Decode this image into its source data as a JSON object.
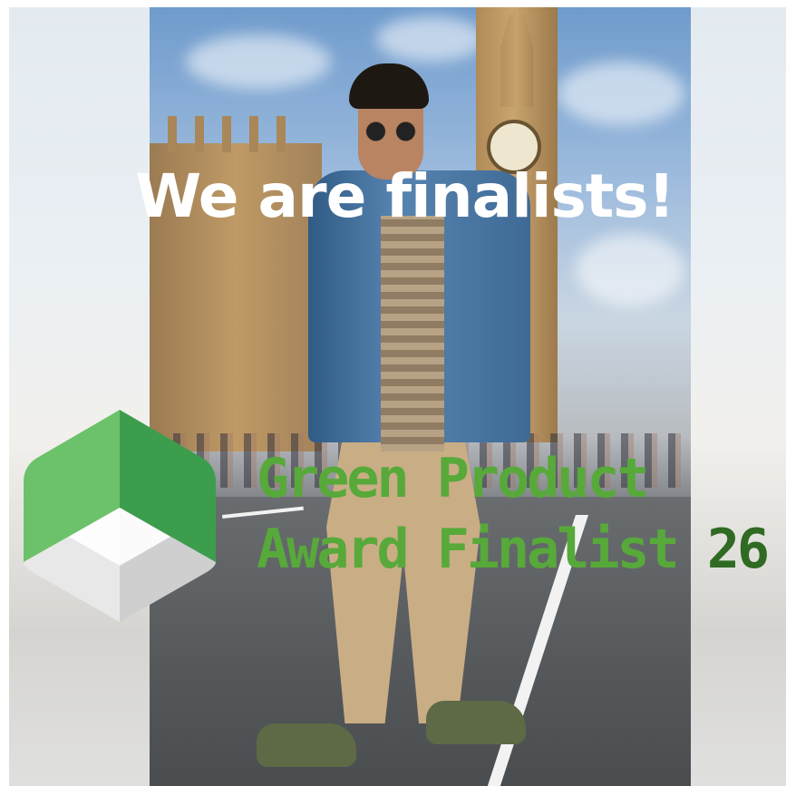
{
  "headline": "We are finalists!",
  "award": {
    "line1": "Green Product",
    "line2": "Award Finalist",
    "year": "26"
  },
  "colors": {
    "headline": "#ffffff",
    "award_text": "#57a93a",
    "award_year": "#2f6b22",
    "logo_green_light": "#6cc26a",
    "logo_green_dark": "#3c9e4d",
    "logo_grey": "#dcdcdc"
  },
  "icons": [
    "green-product-award-logo"
  ]
}
